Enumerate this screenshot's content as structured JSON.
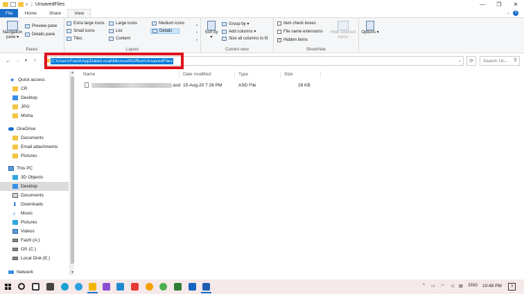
{
  "window": {
    "title": "UnsavedFiles",
    "qa_dropdown": "v",
    "controls": {
      "minimize": "—",
      "maximize": "❐",
      "close": "✕"
    }
  },
  "ribbon_tabs": [
    {
      "label": "File"
    },
    {
      "label": "Home"
    },
    {
      "label": "Share"
    },
    {
      "label": "View"
    }
  ],
  "ribbon": {
    "panes": {
      "navigation_pane": "Navigation pane ▾",
      "preview_pane": "Preview pane",
      "details_pane": "Details pane",
      "group_label": "Panes"
    },
    "layout": {
      "extra_large_icons": "Extra large icons",
      "large_icons": "Large icons",
      "medium_icons": "Medium icons",
      "small_icons": "Small icons",
      "list": "List",
      "details": "Details",
      "tiles": "Tiles",
      "content": "Content",
      "group_label": "Layout"
    },
    "current_view": {
      "sort_by": "Sort by ▾",
      "group_by": "Group by ▾",
      "add_columns": "Add columns ▾",
      "size_all_columns": "Size all columns to fit",
      "group_label": "Current view"
    },
    "show_hide": {
      "item_check_boxes": "Item check boxes",
      "file_name_extensions": "File name extensions",
      "hidden_items": "Hidden items",
      "hide_selected_items": "Hide selected items",
      "group_label": "Show/hide"
    },
    "options": "Options ▾"
  },
  "address_bar": {
    "path": "C:\\Users\\Faizii\\AppData\\Local\\Microsoft\\Office\\UnsavedFiles",
    "search_placeholder": "Search Un...",
    "back": "←",
    "forward": "→",
    "recent": "▾",
    "up": "↑",
    "refresh": "⟳"
  },
  "sidebar": [
    {
      "label": "Quick access",
      "icon": "star-icon"
    },
    {
      "label": "CR",
      "icon": "folder-icon"
    },
    {
      "label": "Desktop",
      "icon": "desktop-icon"
    },
    {
      "label": "JPG",
      "icon": "folder-icon"
    },
    {
      "label": "Misha",
      "icon": "folder-icon"
    },
    {
      "label": "OneDrive",
      "icon": "cloud-icon"
    },
    {
      "label": "Documents",
      "icon": "folder-icon"
    },
    {
      "label": "Email attachments",
      "icon": "folder-icon"
    },
    {
      "label": "Pictures",
      "icon": "folder-icon"
    },
    {
      "label": "This PC",
      "icon": "pc-icon"
    },
    {
      "label": "3D Objects",
      "icon": "3d-icon"
    },
    {
      "label": "Desktop",
      "icon": "desktop-icon"
    },
    {
      "label": "Documents",
      "icon": "documents-icon"
    },
    {
      "label": "Downloads",
      "icon": "download-icon"
    },
    {
      "label": "Music",
      "icon": "music-icon"
    },
    {
      "label": "Pictures",
      "icon": "pictures-icon"
    },
    {
      "label": "Videos",
      "icon": "videos-icon"
    },
    {
      "label": "Faizll  (A:)",
      "icon": "drive-icon"
    },
    {
      "label": "OS (C:)",
      "icon": "drive-icon"
    },
    {
      "label": "Local Disk (E:)",
      "icon": "drive-icon"
    },
    {
      "label": "Network",
      "icon": "network-icon"
    }
  ],
  "file_list": {
    "columns": [
      "Name",
      "Date modified",
      "Type",
      "Size"
    ],
    "rows": [
      {
        "name_suffix": ".asd",
        "date_modified": "15-Aug-20 7:26 PM",
        "type": "ASD File",
        "size": "28 KB"
      }
    ]
  },
  "taskbar": {
    "language": "ENG",
    "time": "10:48 PM",
    "notifications": "3",
    "tray_arrow": "^"
  },
  "colors": {
    "accent": "#1a6fc9",
    "highlight_box": "#e0101a",
    "selection": "#0078d7"
  }
}
